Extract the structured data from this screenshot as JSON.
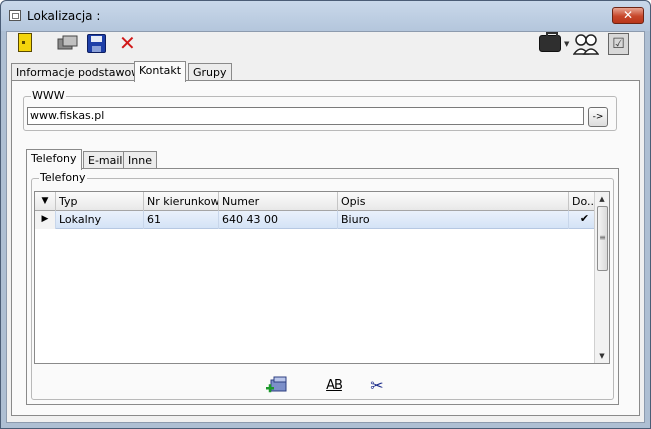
{
  "window": {
    "title": "Lokalizacja :",
    "close_symbol": "✕"
  },
  "toolbar": {
    "icons": [
      "door-exit-icon",
      "duplicate-icon",
      "save-icon",
      "delete-icon",
      "briefcase-icon",
      "people-icon",
      "checkbox-icon"
    ],
    "delete_symbol": "✕",
    "checkbox_symbol": "☑",
    "dropdown_symbol": "▼"
  },
  "main_tabs": [
    {
      "label": "Informacje podstawowe",
      "active": false
    },
    {
      "label": "Kontakt",
      "active": true
    },
    {
      "label": "Grupy",
      "active": false
    }
  ],
  "www": {
    "legend": "WWW",
    "value": "www.fiskas.pl",
    "go_label": "->"
  },
  "contact_tabs": [
    {
      "label": "Telefony",
      "active": true
    },
    {
      "label": "E-mail",
      "active": false
    },
    {
      "label": "Inne",
      "active": false
    }
  ],
  "phones": {
    "legend": "Telefony",
    "columns": [
      "Typ",
      "Nr kierunkowy",
      "Numer",
      "Opis",
      "Do..."
    ],
    "sort_symbol": "▼",
    "row_marker": "▶",
    "rows": [
      {
        "typ": "Lokalny",
        "nr_kierunkowy": "61",
        "numer": "640 43 00",
        "opis": "Biuro",
        "default": "✔"
      }
    ],
    "scroll_up": "▲",
    "scroll_down": "▼",
    "thumb_grip": "≡"
  },
  "bottom_actions": {
    "rename_label": "AB",
    "cut_symbol": "✂"
  }
}
